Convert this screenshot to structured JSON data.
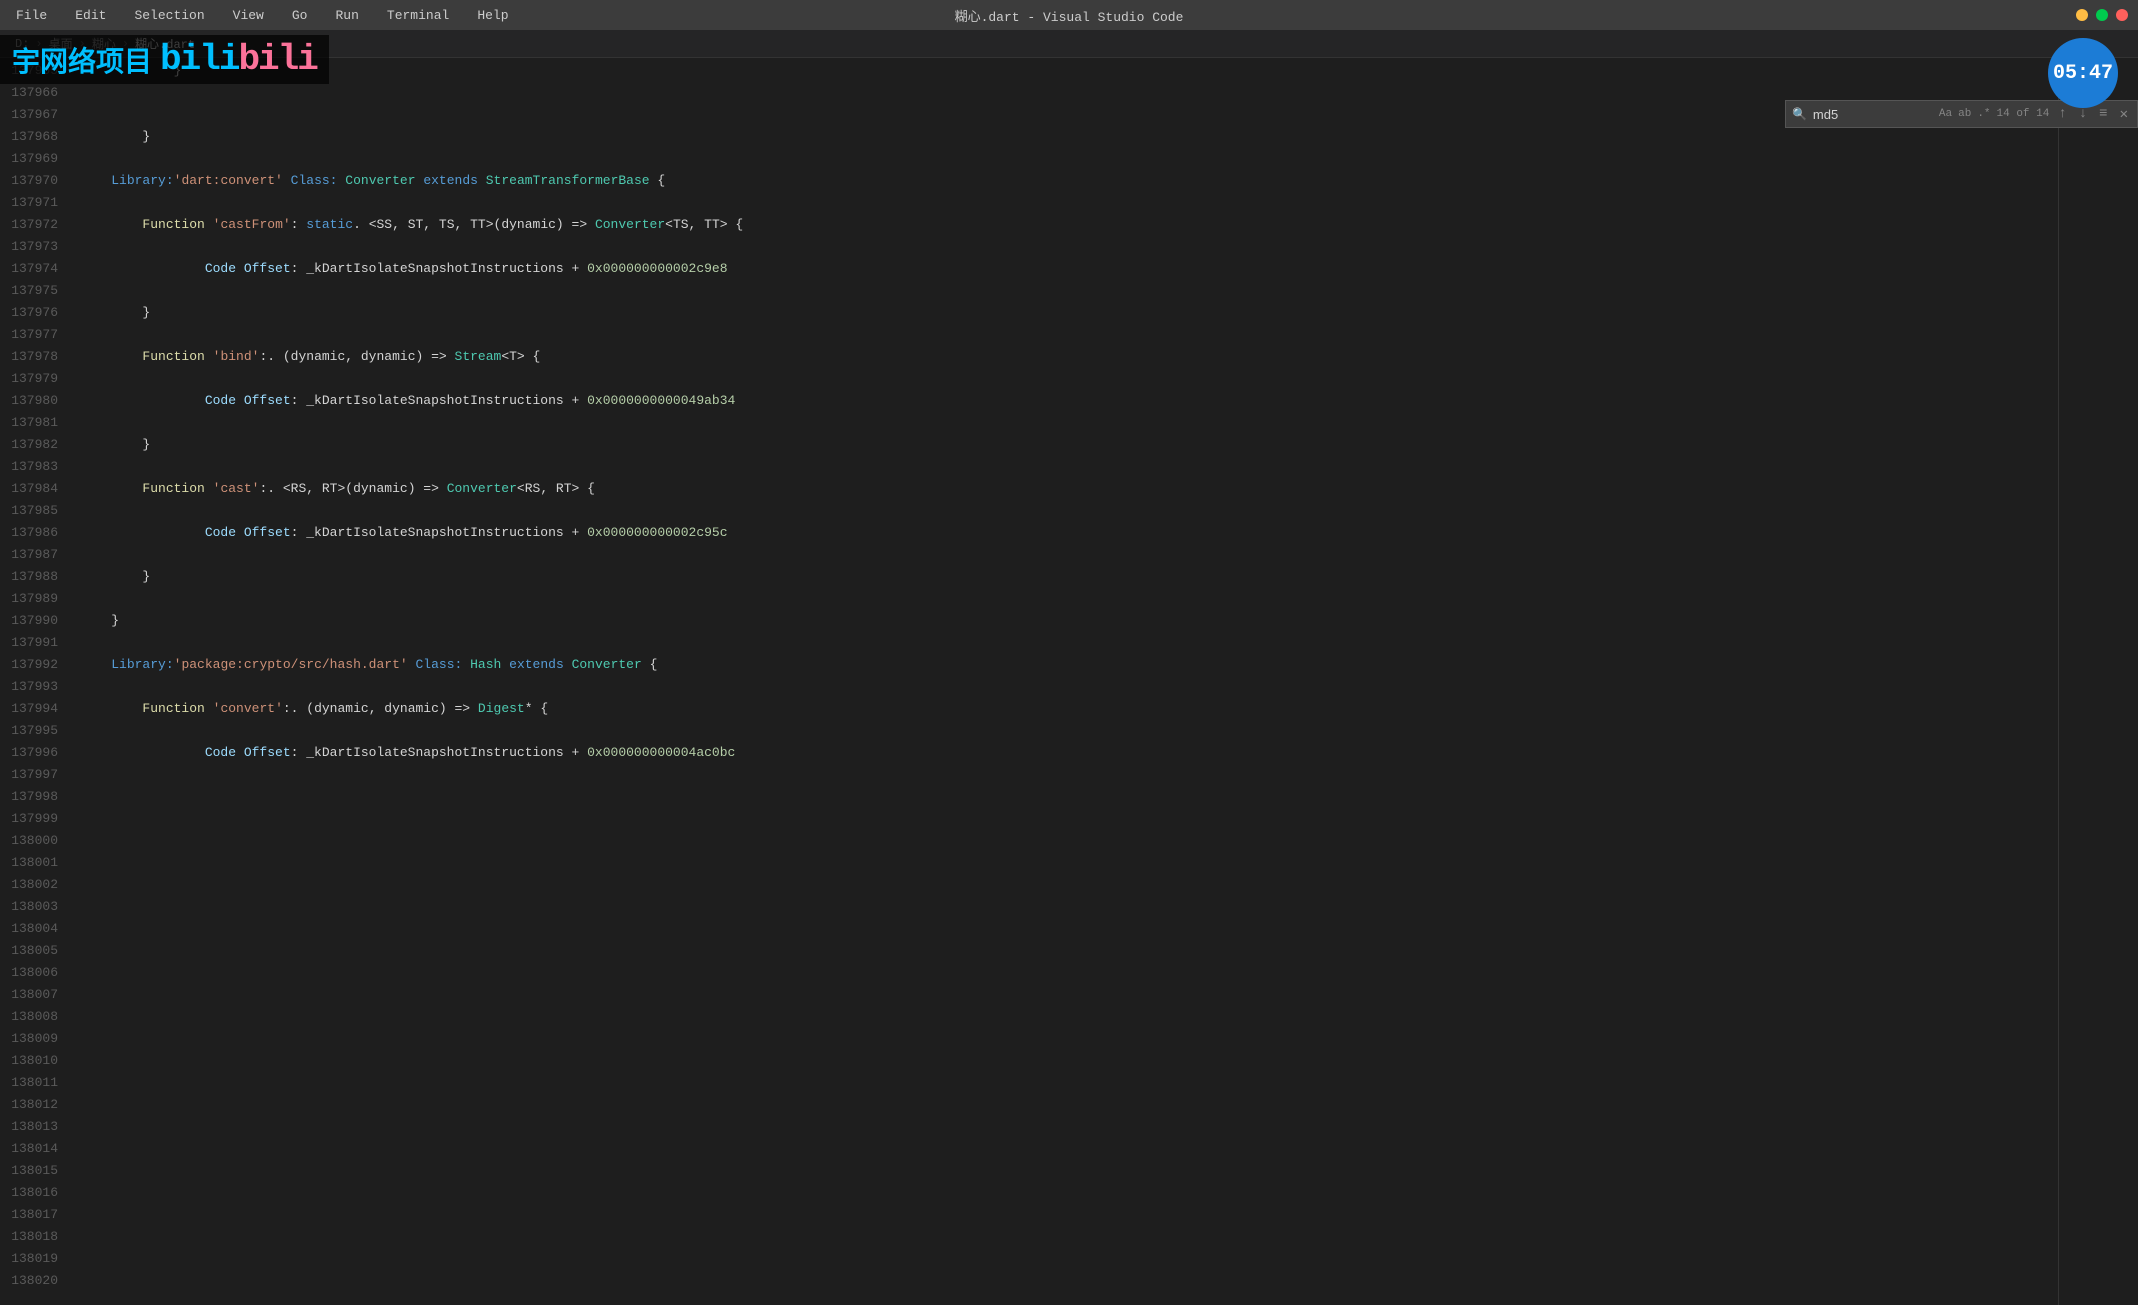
{
  "titlebar": {
    "menu_items": [
      "File",
      "Edit",
      "Selection",
      "View",
      "Go",
      "Run",
      "Terminal",
      "Help"
    ],
    "title": "糊心.dart - Visual Studio Code",
    "window_controls": [
      "minimize",
      "maximize",
      "close"
    ]
  },
  "breadcrumb": {
    "path": [
      "D:",
      "桌面",
      "糊心",
      "糊心.dart"
    ]
  },
  "search": {
    "query": "md5",
    "count": "14 of 14",
    "placeholder": "md5"
  },
  "timer": {
    "time": "05:47"
  },
  "overlay": {
    "channel": "宇网络项目",
    "logo": "bilibili"
  },
  "lines": [
    {
      "num": "137965",
      "content": "            }"
    },
    {
      "num": "137966",
      "content": ""
    },
    {
      "num": "137967",
      "content": ""
    },
    {
      "num": "137968",
      "content": "        }"
    },
    {
      "num": "137969",
      "content": ""
    },
    {
      "num": "137970",
      "content": "    Library:'dart:convert' Class: Converter extends StreamTransformerBase {",
      "type": "library-class"
    },
    {
      "num": "137971",
      "content": ""
    },
    {
      "num": "137972",
      "content": "        Function 'castFrom': static. <SS, ST, TS, TT>(dynamic) => Converter<TS, TT> {",
      "type": "function"
    },
    {
      "num": "137973",
      "content": ""
    },
    {
      "num": "137974",
      "content": "                Code Offset: _kDartIsolateSnapshotInstructions + 0x000000000002c9e8"
    },
    {
      "num": "137975",
      "content": ""
    },
    {
      "num": "137976",
      "content": "        }"
    },
    {
      "num": "137977",
      "content": ""
    },
    {
      "num": "137978",
      "content": "        Function 'bind':. (dynamic, dynamic) => Stream<T> {",
      "type": "function"
    },
    {
      "num": "137979",
      "content": ""
    },
    {
      "num": "137980",
      "content": "                Code Offset: _kDartIsolateSnapshotInstructions + 0x0000000000049ab34"
    },
    {
      "num": "137981",
      "content": ""
    },
    {
      "num": "137982",
      "content": "        }"
    },
    {
      "num": "137983",
      "content": ""
    },
    {
      "num": "137984",
      "content": "        Function 'cast':. <RS, RT>(dynamic) => Converter<RS, RT> {",
      "type": "function"
    },
    {
      "num": "137985",
      "content": ""
    },
    {
      "num": "137986",
      "content": "                Code Offset: _kDartIsolateSnapshotInstructions + 0x000000000002c95c"
    },
    {
      "num": "137987",
      "content": ""
    },
    {
      "num": "137988",
      "content": "        }"
    },
    {
      "num": "137989",
      "content": ""
    },
    {
      "num": "137990",
      "content": "    }"
    },
    {
      "num": "137991",
      "content": ""
    },
    {
      "num": "137992",
      "content": "    Library:'package:crypto/src/hash.dart' Class: Hash extends Converter {",
      "type": "library-class2"
    },
    {
      "num": "137993",
      "content": ""
    },
    {
      "num": "137994",
      "content": "        Function 'convert':. (dynamic, dynamic) => Digest* {",
      "type": "function"
    },
    {
      "num": "137995",
      "content": ""
    },
    {
      "num": "137996",
      "content": "                Code Offset: _kDartIsolateSnapshotInstructions + 0x000000000004ac0bc"
    },
    {
      "num": "137997",
      "content": ""
    }
  ]
}
